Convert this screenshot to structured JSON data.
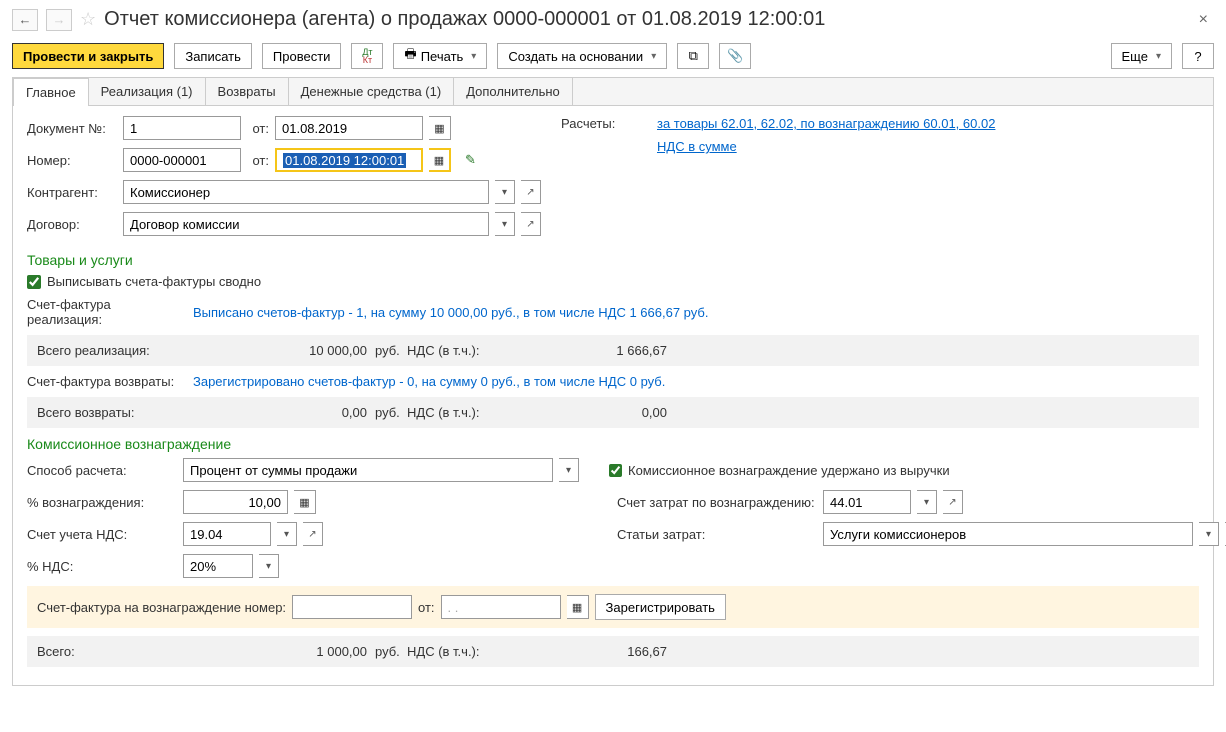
{
  "title": "Отчет комиссионера (агента) о продажах 0000-000001 от 01.08.2019 12:00:01",
  "toolbar": {
    "post_close": "Провести и закрыть",
    "save": "Записать",
    "post": "Провести",
    "print": "Печать",
    "create_based": "Создать на основании",
    "more": "Еще"
  },
  "tabs": {
    "main": "Главное",
    "sales": "Реализация (1)",
    "returns": "Возвраты",
    "cash": "Денежные средства (1)",
    "extra": "Дополнительно"
  },
  "fields": {
    "doc_num_label": "Документ №:",
    "doc_num": "1",
    "from1": "от:",
    "doc_date": "01.08.2019",
    "number_label": "Номер:",
    "number": "0000-000001",
    "from2": "от:",
    "number_date": "01.08.2019 12:00:01",
    "counterparty_label": "Контрагент:",
    "counterparty": "Комиссионер",
    "contract_label": "Договор:",
    "contract": "Договор комиссии",
    "calc_label": "Расчеты:",
    "calc_link": "за товары 62.01, 62.02, по вознаграждению 60.01, 60.02",
    "vat_link": "НДС в сумме"
  },
  "goods": {
    "title": "Товары и услуги",
    "chk_label": "Выписывать счета-фактуры сводно",
    "sf_sales_label": "Счет-фактура реализация:",
    "sf_sales_link": "Выписано счетов-фактур - 1, на сумму 10 000,00 руб., в том числе НДС 1 666,67 руб.",
    "total_sales_label": "Всего реализация:",
    "total_sales_val": "10 000,00",
    "rub": "руб.",
    "vat_incl": "НДС (в т.ч.):",
    "total_sales_vat": "1 666,67",
    "sf_ret_label": "Счет-фактура возвраты:",
    "sf_ret_link": "Зарегистрировано счетов-фактур - 0, на сумму 0 руб., в том числе НДС 0 руб.",
    "total_ret_label": "Всего возвраты:",
    "total_ret_val": "0,00",
    "total_ret_vat": "0,00"
  },
  "commission": {
    "title": "Комиссионное вознаграждение",
    "method_label": "Способ расчета:",
    "method": "Процент от суммы продажи",
    "held_label": "Комиссионное вознаграждение удержано из выручки",
    "pct_label": "% вознаграждения:",
    "pct_val": "10,00",
    "cost_acc_label": "Счет затрат по вознаграждению:",
    "cost_acc": "44.01",
    "vat_acc_label": "Счет учета НДС:",
    "vat_acc": "19.04",
    "cost_item_label": "Статьи затрат:",
    "cost_item": "Услуги комиссионеров",
    "vat_pct_label": "% НДС:",
    "vat_pct": "20%",
    "sf_label": "Счет-фактура на вознаграждение номер:",
    "sf_from": "от:",
    "sf_date_placeholder": ". .",
    "register": "Зарегистрировать",
    "total_label": "Всего:",
    "total_val": "1 000,00",
    "total_vat": "166,67"
  }
}
